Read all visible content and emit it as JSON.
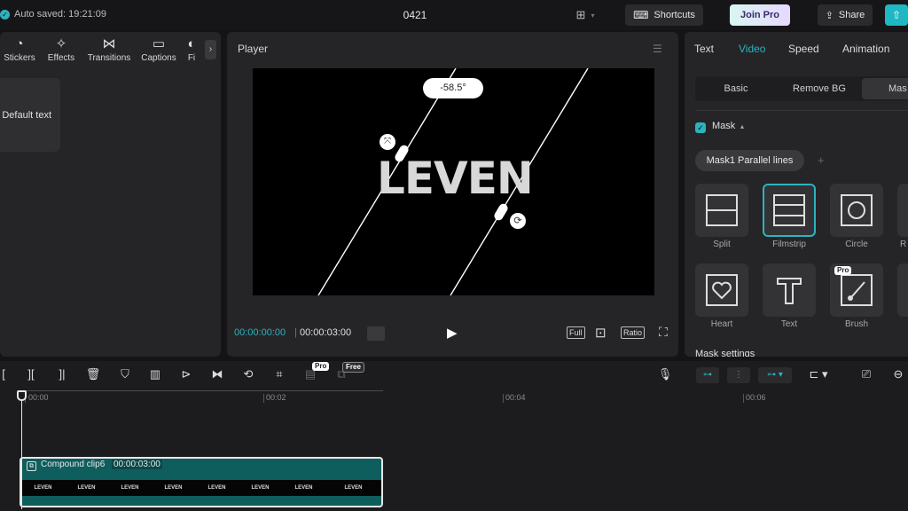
{
  "topbar": {
    "autosave": "Auto saved: 19:21:09",
    "project_title": "0421",
    "shortcuts_label": "Shortcuts",
    "join_pro_label": "Join Pro",
    "share_label": "Share"
  },
  "media_tools": [
    {
      "label": "Stickers",
      "icon": "stickers-icon",
      "glyph": "◔"
    },
    {
      "label": "Effects",
      "icon": "effects-icon",
      "glyph": "✧"
    },
    {
      "label": "Transitions",
      "icon": "transitions-icon",
      "glyph": "⋈"
    },
    {
      "label": "Captions",
      "icon": "captions-icon",
      "glyph": "▭"
    },
    {
      "label": "Fi",
      "icon": "filters-icon",
      "glyph": "◐"
    }
  ],
  "text_preset": {
    "label": "Default text"
  },
  "player": {
    "title": "Player",
    "angle": "-58.5°",
    "video_text": "LEVEN",
    "current_time": "00:00:00:00",
    "duration": "00:00:03:00",
    "full_label": "Full",
    "ratio_label": "Ratio"
  },
  "right_panel": {
    "tabs": [
      "Text",
      "Video",
      "Speed",
      "Animation"
    ],
    "active_tab": "Video",
    "subtabs": [
      "Basic",
      "Remove BG",
      "Mas"
    ],
    "mask_label": "Mask",
    "mask_chip": "Mask1 Parallel lines",
    "shapes": [
      {
        "label": "Split",
        "icon": "split-mask-icon"
      },
      {
        "label": "Filmstrip",
        "icon": "filmstrip-mask-icon"
      },
      {
        "label": "Circle",
        "icon": "circle-mask-icon"
      },
      {
        "label": "R",
        "icon": "rectangle-mask-icon"
      },
      {
        "label": "Heart",
        "icon": "heart-mask-icon"
      },
      {
        "label": "Text",
        "icon": "text-mask-icon"
      },
      {
        "label": "Brush",
        "icon": "brush-mask-icon"
      }
    ],
    "pro_badge": "Pro",
    "mask_settings": "Mask settings"
  },
  "timeline": {
    "pro_badge": "Pro",
    "free_badge": "Free",
    "ruler": [
      "00:00",
      "00:02",
      "00:04",
      "00:06"
    ],
    "clip_name": "Compound clip6",
    "clip_duration": "00:00:03:00",
    "thumb_text": "LEVEN"
  },
  "colors": {
    "accent": "#2bb3c0",
    "background": "#141416",
    "panel": "#252527",
    "clip": "#0f5e5e"
  }
}
